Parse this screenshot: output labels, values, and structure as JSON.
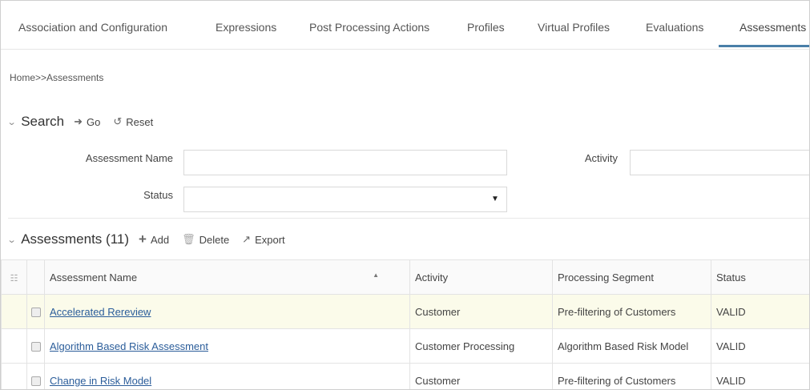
{
  "tabs": {
    "items": [
      "Association and Configuration",
      "Expressions",
      "Post Processing Actions",
      "Profiles",
      "Virtual Profiles",
      "Evaluations",
      "Assessments"
    ],
    "active": "Assessments",
    "underline_color": "#4a7fa8"
  },
  "breadcrumb": "Home>>Assessments",
  "search": {
    "title": "Search",
    "go_label": "Go",
    "reset_label": "Reset",
    "fields": {
      "assessment_name_label": "Assessment Name",
      "assessment_name_value": "",
      "activity_label": "Activity",
      "activity_value": "",
      "status_label": "Status",
      "status_value": ""
    }
  },
  "assessments": {
    "title": "Assessments (11)",
    "add_label": "Add",
    "delete_label": "Delete",
    "export_label": "Export",
    "columns": [
      "Assessment Name",
      "Activity",
      "Processing Segment",
      "Status"
    ],
    "rows": [
      {
        "name": "Accelerated Rereview",
        "activity": "Customer",
        "segment": "Pre-filtering of Customers",
        "status": "VALID"
      },
      {
        "name": "Algorithm Based Risk Assessment",
        "activity": "Customer Processing",
        "segment": "Algorithm Based Risk Model",
        "status": "VALID"
      },
      {
        "name": "Change in Risk Model",
        "activity": "Customer",
        "segment": "Pre-filtering of Customers",
        "status": "VALID"
      }
    ]
  },
  "colors": {
    "link": "#2b5d9a",
    "row_highlight": "#fbfbea"
  },
  "icons": [
    "chevron-down-icon",
    "arrow-right-icon",
    "reset-icon",
    "plus-icon",
    "trash-icon",
    "export-icon",
    "sort-asc-icon",
    "column-settings-icon",
    "dropdown-caret-icon"
  ]
}
